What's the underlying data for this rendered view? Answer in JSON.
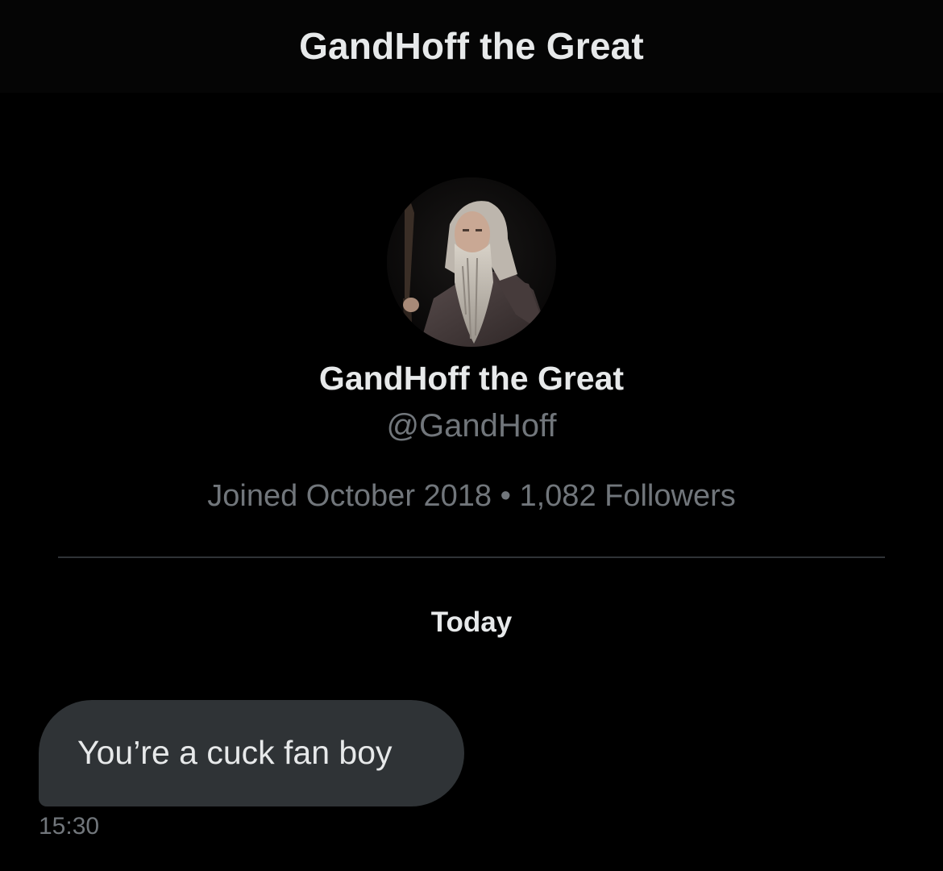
{
  "header": {
    "title": "GandHoff the Great"
  },
  "profile": {
    "avatar_icon": "wizard-avatar",
    "name": "GandHoff the Great",
    "handle": "@GandHoff",
    "meta": "Joined October 2018 • 1,082 Followers"
  },
  "conversation": {
    "date_label": "Today",
    "messages": [
      {
        "text": "You’re a cuck fan boy",
        "time": "15:30"
      }
    ]
  },
  "colors": {
    "background": "#000000",
    "primary_text": "#e7e9ea",
    "secondary_text": "#71767b",
    "bubble": "#2f3336",
    "divider": "#2f3336"
  }
}
